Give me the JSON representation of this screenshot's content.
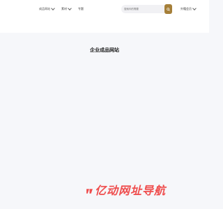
{
  "header": {
    "nav": [
      {
        "label": "成品网站"
      },
      {
        "label": "素材"
      },
      {
        "label": "专题"
      }
    ],
    "search": {
      "placeholder": "搜索你的需要"
    },
    "language": "外籍会员"
  },
  "main": {
    "title": "企业成品网站"
  },
  "watermark": {
    "text": "亿动网址导航"
  },
  "colors": {
    "accent": "#a57f39",
    "background": "#f6f7fa",
    "watermark": "#ef4d4d"
  }
}
